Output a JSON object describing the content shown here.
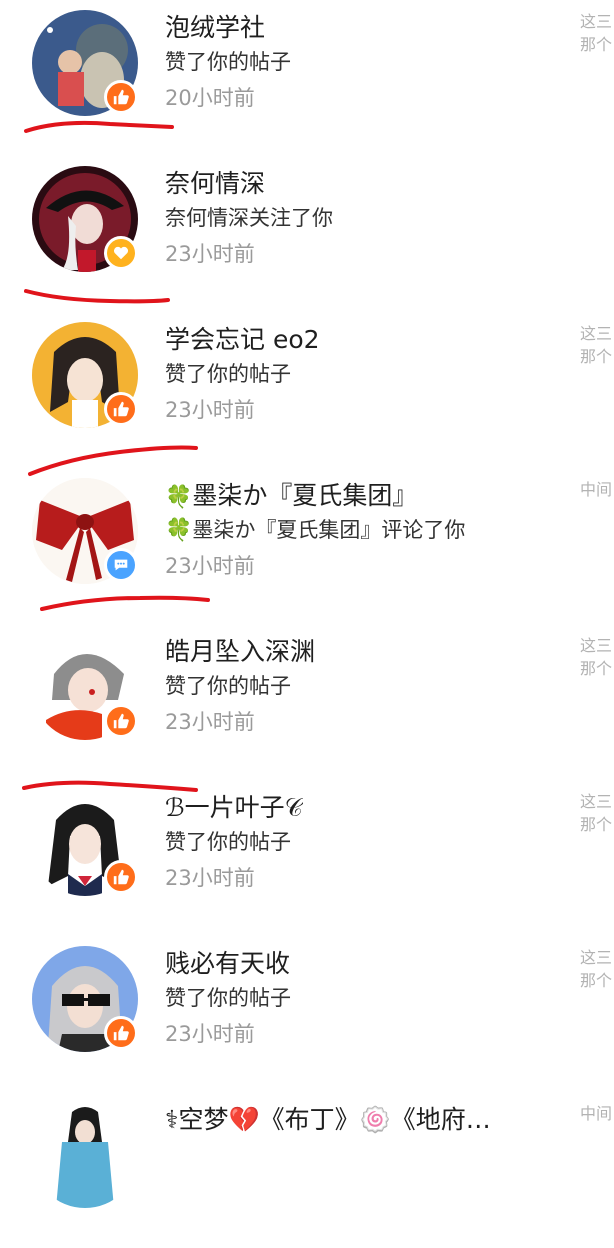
{
  "notifications": [
    {
      "name": "泡绒学社",
      "action": "赞了你的帖子",
      "time": "20小时前",
      "badge": "like",
      "preview": [
        "这三",
        "那个"
      ],
      "avatar_color": "#3b5a8c"
    },
    {
      "name": "奈何情深",
      "action": "奈何情深关注了你",
      "time": "23小时前",
      "badge": "follow",
      "preview": [],
      "avatar_color": "#7a1b2a"
    },
    {
      "name": "学会忘记 eo2",
      "action": "赞了你的帖子",
      "time": "23小时前",
      "badge": "like",
      "preview": [
        "这三",
        "那个"
      ],
      "avatar_color": "#f3b233"
    },
    {
      "name": "墨柒か『夏氏集团』",
      "action": "墨柒か『夏氏集团』评论了你",
      "time": "23小时前",
      "badge": "comment",
      "preview": [
        "中间"
      ],
      "avatar_color": "#fbf7f2",
      "name_prefix": "🍀",
      "action_prefix": "🍀"
    },
    {
      "name": "皓月坠入深渊",
      "action": "赞了你的帖子",
      "time": "23小时前",
      "badge": "like",
      "preview": [
        "这三",
        "那个"
      ],
      "avatar_color": "#ffffff"
    },
    {
      "name": "ℬ一片叶子𝒞",
      "action": "赞了你的帖子",
      "time": "23小时前",
      "badge": "like",
      "preview": [
        "这三",
        "那个"
      ],
      "avatar_color": "#ffffff"
    },
    {
      "name": "贱必有天收",
      "action": "赞了你的帖子",
      "time": "23小时前",
      "badge": "like",
      "preview": [
        "这三",
        "那个"
      ],
      "avatar_color": "#7fa7e8"
    },
    {
      "name": "⚕空梦💔《布丁》🍥《地府…",
      "action": "",
      "time": "",
      "badge": "",
      "preview": [
        "中间"
      ],
      "avatar_color": "#ffffff"
    }
  ],
  "colors": {
    "like": "#ff6d1a",
    "follow": "#ffb21e",
    "comment": "#4aa3ff",
    "annotation": "#e0141b"
  }
}
